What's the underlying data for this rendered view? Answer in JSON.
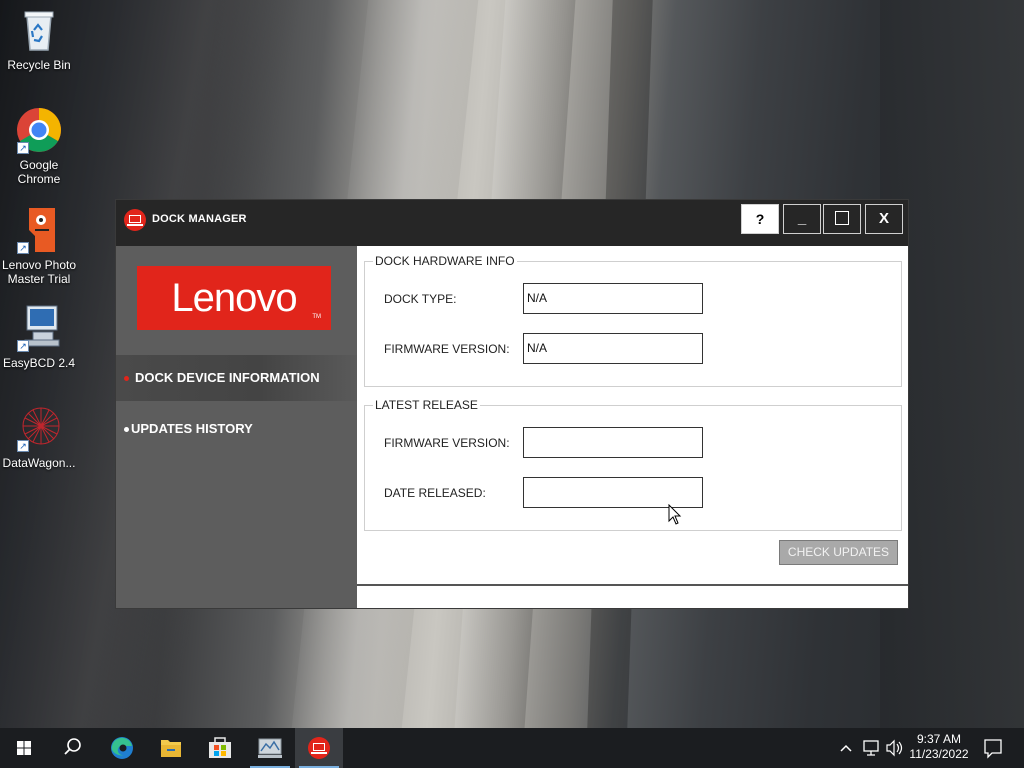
{
  "desktop": {
    "icons": [
      {
        "label": "Recycle Bin",
        "icon": "recycle-bin-icon"
      },
      {
        "label": "Google Chrome",
        "icon": "chrome-icon"
      },
      {
        "label": "Lenovo Photo Master Trial",
        "icon": "lenovo-photo-master-icon"
      },
      {
        "label": "EasyBCD 2.4",
        "icon": "easybcd-icon"
      },
      {
        "label": "DataWagon...",
        "icon": "datawagon-icon"
      }
    ]
  },
  "window": {
    "title": "DOCK MANAGER",
    "buttons": {
      "help": "?",
      "minimize": "_",
      "maximize": "",
      "close": "X"
    },
    "logo_text": "Lenovo",
    "logo_tm": "TM",
    "nav": [
      {
        "label": "DOCK DEVICE INFORMATION",
        "active": true
      },
      {
        "label": "UPDATES HISTORY",
        "active": false
      }
    ],
    "hardware": {
      "legend": "DOCK HARDWARE INFO",
      "dock_type_label": "DOCK TYPE:",
      "dock_type_value": "N/A",
      "firmware_label": "FIRMWARE VERSION:",
      "firmware_value": "N/A"
    },
    "latest": {
      "legend": "LATEST RELEASE",
      "firmware_label": "FIRMWARE VERSION:",
      "firmware_value": "",
      "date_label": "DATE RELEASED:",
      "date_value": ""
    },
    "check_updates_label": "CHECK UPDATES"
  },
  "taskbar": {
    "apps": [
      "start-icon",
      "search-icon",
      "edge-icon",
      "file-explorer-icon",
      "store-icon",
      "monitor-app-icon",
      "dock-manager-icon"
    ],
    "time": "9:37 AM",
    "date": "11/23/2022"
  },
  "colors": {
    "lenovo_red": "#e1251b",
    "sidebar": "#5d5d5d",
    "titlebar": "#262626",
    "button_gray": "#a9a9a9"
  }
}
